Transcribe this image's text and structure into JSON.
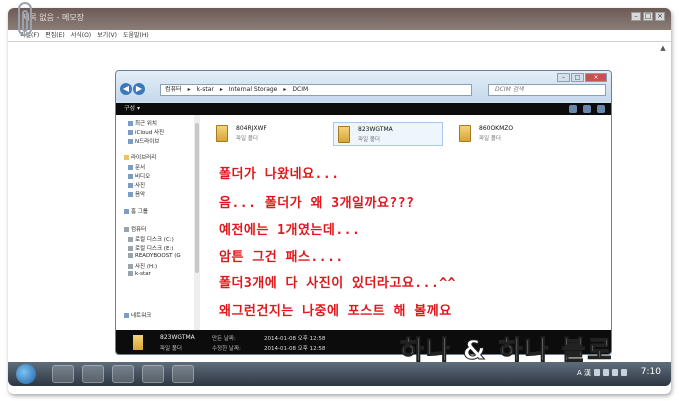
{
  "notepad": {
    "title": "제목 없음 - 메모장",
    "menu": [
      "파일(F)",
      "편집(E)",
      "서식(O)",
      "보기(V)",
      "도움말(H)"
    ]
  },
  "explorer": {
    "breadcrumb": [
      "컴퓨터",
      "k-star",
      "Internal Storage",
      "DCIM"
    ],
    "search_placeholder": "DCIM 검색",
    "toolbar_label": "구성 ▾",
    "nav": {
      "favorites": [
        "최근 위치",
        "iCloud 사진",
        "N드라이브"
      ],
      "libraries_header": "라이브러리",
      "libraries": [
        "문서",
        "비디오",
        "사진",
        "음악"
      ],
      "homegroup": "홈 그룹",
      "computer_header": "컴퓨터",
      "computer": [
        "로컬 디스크 (C:)",
        "로컬 디스크 (E:)",
        "READYBOOST (G",
        "사진 (H:)",
        "k-star"
      ],
      "network": "네트워크"
    },
    "folders": [
      {
        "name": "804RJXWF",
        "type": "파일 폴더"
      },
      {
        "name": "823WGTMA",
        "type": "파일 폴더"
      },
      {
        "name": "860OKMZO",
        "type": "파일 폴더"
      }
    ],
    "details": {
      "name": "823WGTMA",
      "type": "파일 폴더",
      "created_label": "만든 날짜:",
      "created": "2014-01-08 오후 12:58",
      "modified_label": "수정한 날짜:",
      "modified": "2014-01-08 오후 12:58"
    }
  },
  "overlay_text": [
    "폴더가 나왔네요...",
    "음... 폴더가 왜 3개일까요???",
    "예전에는 1개였는데...",
    "암튼 그건 패스....",
    "폴더3개에 다 사진이 있더라고요...^^",
    "왜그런건지는 나중에 포스트 해 볼께요"
  ],
  "watermark": "하나 & 하나 블로",
  "taskbar": {
    "clock": "7:10",
    "tray_text": "A 漢"
  },
  "colors": {
    "overlay_red": "#e0171c",
    "explorer_chrome": "#cde0f0",
    "dark_bars": "#0c0c0c"
  }
}
